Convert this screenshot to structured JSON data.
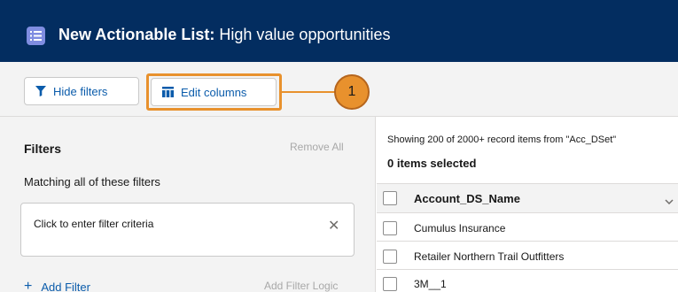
{
  "header": {
    "title_bold": "New Actionable List:",
    "title_rest": "High value opportunities",
    "icon": "list-icon",
    "background_color": "#032d60"
  },
  "toolbar": {
    "hide_filters_label": "Hide filters",
    "hide_filters_icon": "filter-funnel-icon",
    "edit_columns_label": "Edit columns",
    "edit_columns_icon": "table-columns-icon",
    "callout_number": "1",
    "callout_color": "#e8912d"
  },
  "filters": {
    "title": "Filters",
    "remove_all": "Remove All",
    "matching": "Matching all of these filters",
    "criteria_placeholder": "Click to enter filter criteria",
    "clear_icon": "close-icon",
    "add_filter": "Add Filter",
    "add_filter_logic": "Add Filter Logic"
  },
  "results": {
    "showing": "Showing 200 of 2000+ record items from \"Acc_DSet\"",
    "selected": "0 items selected",
    "column_header": "Account_DS_Name",
    "rows": [
      "Cumulus Insurance",
      "Retailer Northern Trail Outfitters",
      "3M__1"
    ]
  }
}
